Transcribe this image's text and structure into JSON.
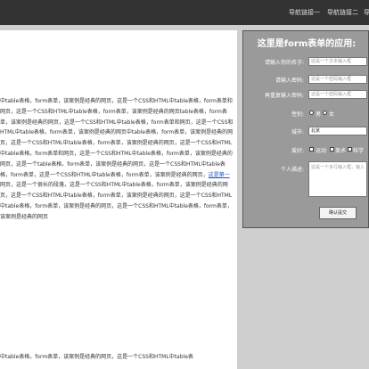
{
  "nav": {
    "item1": "导航链接一",
    "item2": "导航链接二",
    "item3": "导"
  },
  "article": {
    "paragraph1_before_link": "中table表格，form表单，该案例是经典的网页，这是一个CSS和HTML中table表格，form表单和网页，这是一个CSS和HTML中table表格，form表单，该案例是经典的网页table表格，form表单，该案例是经典的网页，这是一个CSS和HTML中table表格，form表单和网页，这是一个CSS和HTML中table表格，form表单，该案例是经典的网页中table表格，form表单，该案例是经典的网页，这是一个CSS和HTML中table表格，form表单，该案例是经典的网页，这是一个CSS和HTML中table表格，form表单和网页，这是一个CSS和HTML中table表格，form表单，该案例是经典的网页，这是一个table表格，form表单，该案例是经典的网页，这是一个CSS和HTML中table表格，form表单，这是一个CSS和HTML中table表格，form表单，该案例是经典的网页，",
    "link_text": "这是第一",
    "paragraph1_after_link": "网页，这是一个很长的段落，这是一个CSS和HTML中table表格，form表单，该案例是经典的网页，这是一个CSS和HTML中table表格，form表单，该案例是经典的网页，这是一个CSS和HTML中table表格，form表单，该案例是经典的网页，这是一个CSS和HTML中table表格，form表单，该案例是经典的网页",
    "paragraph2": "中table表格，form表单，该案例是经典的网页，这是一个CSS和HTML中table表"
  },
  "form": {
    "title": "这里是form表单的应用:",
    "username_label": "请输入你的名字:",
    "username_placeholder": "这是一个文本输入框",
    "password_label": "请输入密码:",
    "password_placeholder": "这是一个密码输入框",
    "confirm_label": "再重复输入密码:",
    "confirm_placeholder": "这是一个密码输入框",
    "gender_label": "性别:",
    "gender_male": "男",
    "gender_female": "女",
    "city_label": "城市:",
    "city_value": "北京",
    "hobby_label": "爱好:",
    "hobby_1": "运动",
    "hobby_2": "美术",
    "hobby_3": "科学",
    "intro_label": "个人描述:",
    "intro_placeholder": "这是一个多行输入框，输入",
    "submit_label": "确认提交"
  }
}
